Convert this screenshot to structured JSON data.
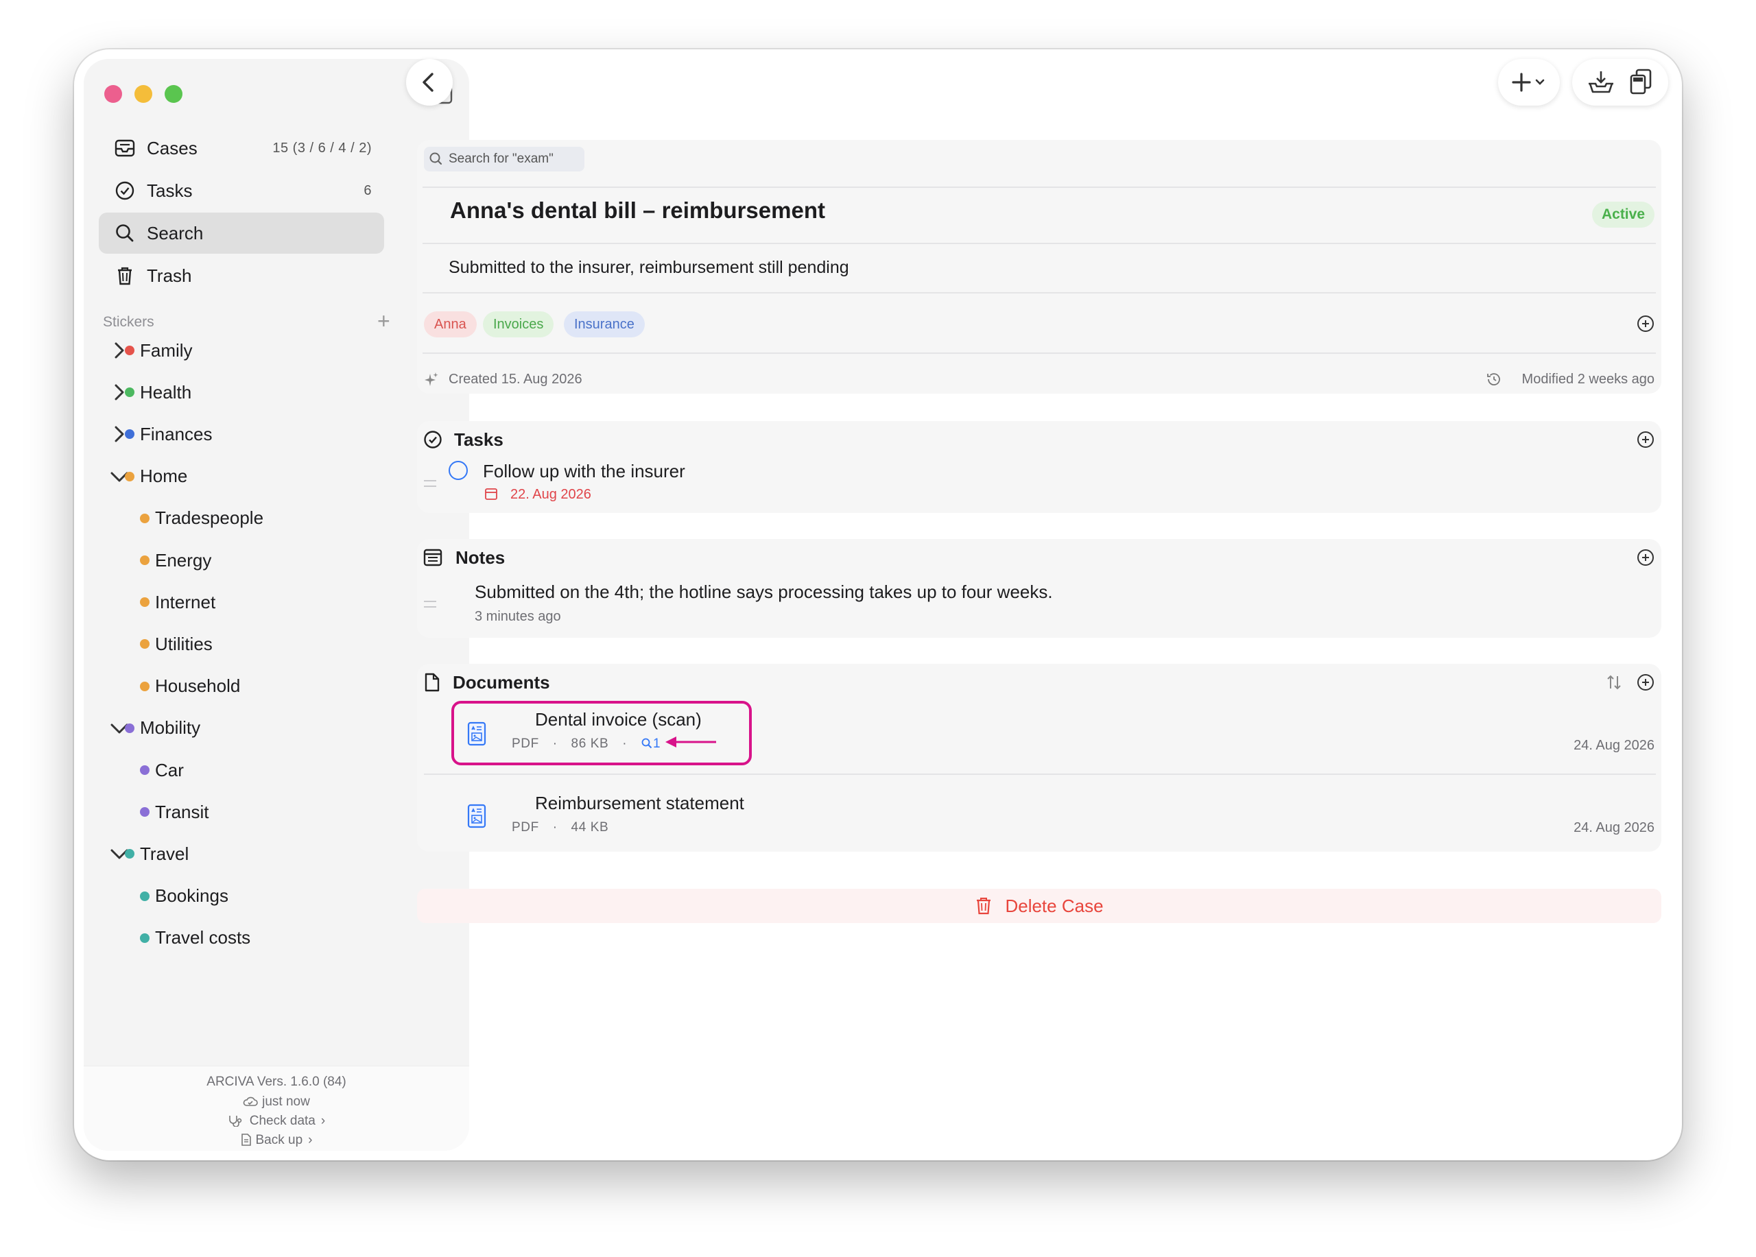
{
  "sidebar": {
    "nav": [
      {
        "label": "Cases",
        "count": "15  (3 / 6 / 4 / 2)",
        "icon": "tray-icon"
      },
      {
        "label": "Tasks",
        "count": "6",
        "icon": "checkmark-circle-icon"
      },
      {
        "label": "Search",
        "count": "",
        "icon": "search-icon",
        "active": true
      },
      {
        "label": "Trash",
        "count": "",
        "icon": "trash-icon"
      }
    ],
    "stickers_heading": "Stickers",
    "stickers": [
      {
        "label": "Family",
        "color": "#e5534b",
        "level": 0,
        "expanded": false
      },
      {
        "label": "Health",
        "color": "#4cb860",
        "level": 0,
        "expanded": false
      },
      {
        "label": "Finances",
        "color": "#3f6fd8",
        "level": 0,
        "expanded": false
      },
      {
        "label": "Home",
        "color": "#eba23e",
        "level": 0,
        "expanded": true
      },
      {
        "label": "Tradespeople",
        "color": "#eba23e",
        "level": 1
      },
      {
        "label": "Energy",
        "color": "#eba23e",
        "level": 1
      },
      {
        "label": "Internet",
        "color": "#eba23e",
        "level": 1
      },
      {
        "label": "Utilities",
        "color": "#eba23e",
        "level": 1
      },
      {
        "label": "Household",
        "color": "#eba23e",
        "level": 1
      },
      {
        "label": "Mobility",
        "color": "#8a6fd6",
        "level": 0,
        "expanded": true
      },
      {
        "label": "Car",
        "color": "#8a6fd6",
        "level": 1
      },
      {
        "label": "Transit",
        "color": "#8a6fd6",
        "level": 1
      },
      {
        "label": "Travel",
        "color": "#41b0a6",
        "level": 0,
        "expanded": true
      },
      {
        "label": "Bookings",
        "color": "#41b0a6",
        "level": 1
      },
      {
        "label": "Travel costs",
        "color": "#41b0a6",
        "level": 1
      }
    ],
    "footer": {
      "version": "ARCIVA  Vers. 1.6.0 (84)",
      "sync": "just now",
      "check": "Check data",
      "backup": "Back up"
    }
  },
  "case": {
    "search_hint": "Search for \"exam\"",
    "title": "Anna's dental bill – reimbursement",
    "status": "Active",
    "description": "Submitted to the insurer, reimbursement still pending",
    "tags": [
      {
        "label": "Anna",
        "bg": "#f9e0e0",
        "fg": "#d9534f"
      },
      {
        "label": "Invoices",
        "bg": "#e2f3df",
        "fg": "#4aa84b"
      },
      {
        "label": "Insurance",
        "bg": "#dfe6f7",
        "fg": "#4a72c9"
      }
    ],
    "created": "Created 15. Aug 2026",
    "modified": "Modified 2 weeks ago"
  },
  "tasks": {
    "heading": "Tasks",
    "items": [
      {
        "title": "Follow up with the insurer",
        "due": "22. Aug 2026"
      }
    ]
  },
  "notes": {
    "heading": "Notes",
    "items": [
      {
        "text": "Submitted on the 4th; the hotline says processing takes up to four weeks.",
        "time": "3 minutes ago"
      }
    ]
  },
  "documents": {
    "heading": "Documents",
    "items": [
      {
        "title": "Dental invoice (scan)",
        "type": "PDF",
        "size": "86 KB",
        "matches": "1",
        "date": "24. Aug 2026",
        "highlighted": true
      },
      {
        "title": "Reimbursement statement",
        "type": "PDF",
        "size": "44 KB",
        "date": "24. Aug 2026"
      }
    ]
  },
  "delete_label": "Delete Case",
  "colors": {
    "accent": "#3478f6",
    "highlight": "#d8138a",
    "danger": "#e8453c"
  }
}
